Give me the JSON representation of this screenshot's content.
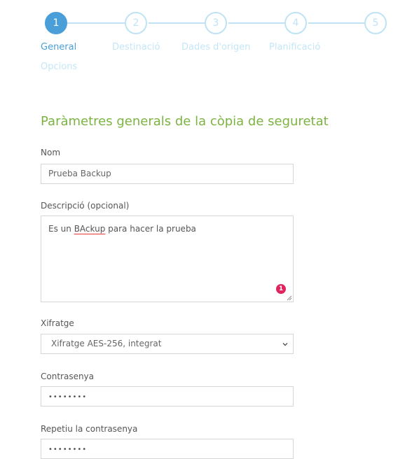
{
  "stepper": {
    "steps": [
      {
        "number": "1",
        "label": "General"
      },
      {
        "number": "2",
        "label": "Destinació"
      },
      {
        "number": "3",
        "label": "Dades d'origen"
      },
      {
        "number": "4",
        "label": "Planificació"
      },
      {
        "number": "5",
        "label": "Opcions"
      }
    ],
    "active_step": 1
  },
  "form": {
    "title": "Paràmetres generals de la còpia de seguretat",
    "name": {
      "label": "Nom",
      "value": "Prueba Backup"
    },
    "description": {
      "label": "Descripció (opcional)",
      "value_pre": "Es un ",
      "value_misspelled": "BAckup",
      "value_post": " para hacer la prueba",
      "spellcheck_badge": "1"
    },
    "encryption": {
      "label": "Xifratge",
      "selected": "Xifratge AES-256, integrat"
    },
    "password": {
      "label": "Contrasenya",
      "masked_value": "••••••••"
    },
    "repeat_password": {
      "label": "Repetiu la contrasenya",
      "masked_value": "••••••••"
    }
  },
  "colors": {
    "active_step": "#4a9fd8",
    "inactive_step": "#bfe3f5",
    "title": "#7cb342",
    "spell_error": "#e53935",
    "badge": "#e0245e"
  }
}
